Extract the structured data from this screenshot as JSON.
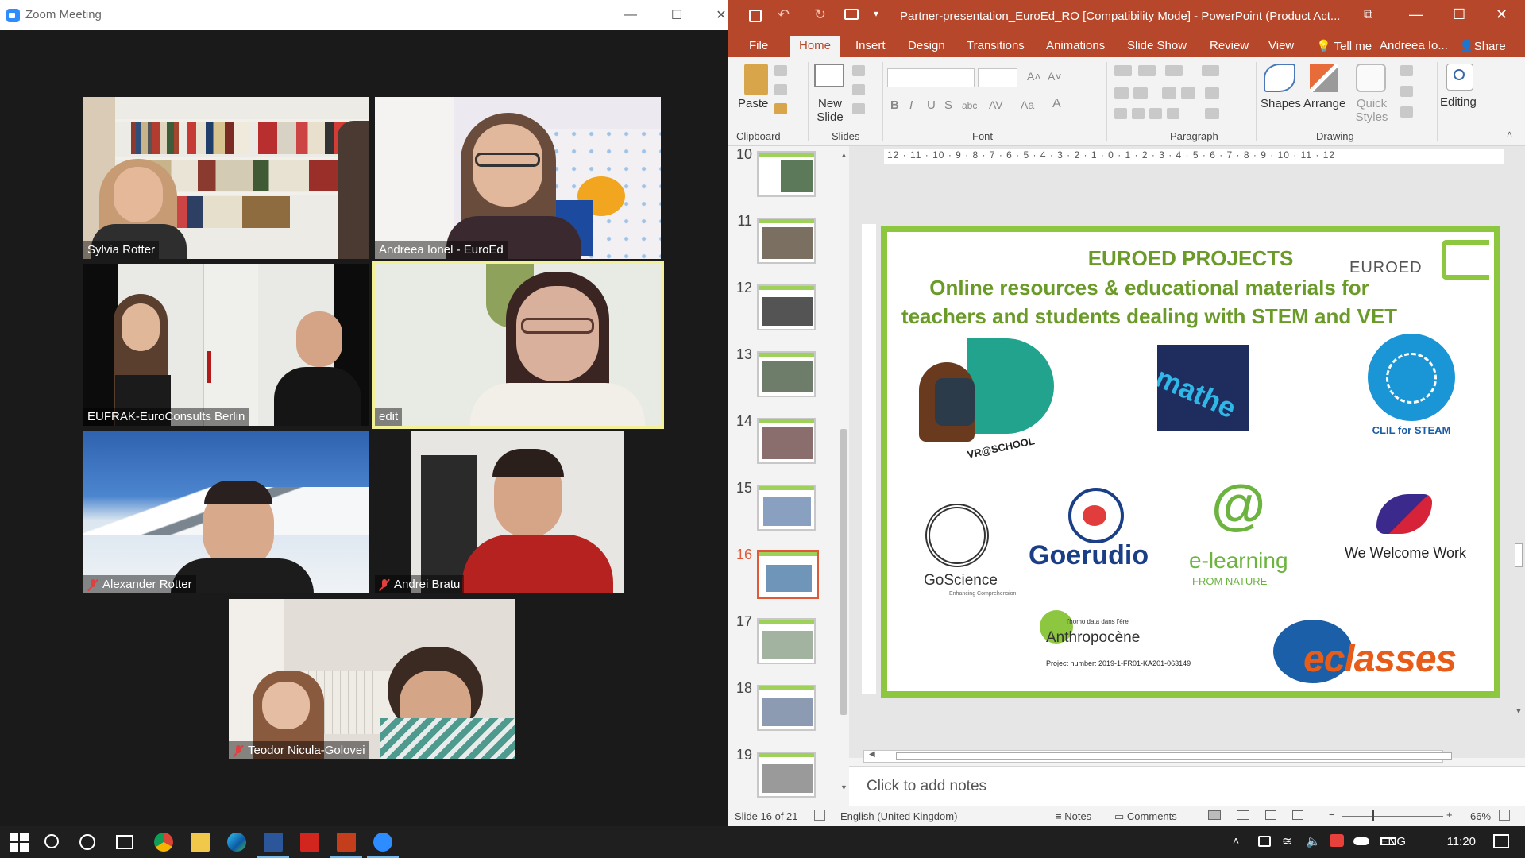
{
  "zoom": {
    "window_title": "Zoom Meeting",
    "participants": [
      {
        "name": "Sylvia Rotter",
        "muted": false
      },
      {
        "name": "Andreea Ionel - EuroEd",
        "muted": false
      },
      {
        "name": "EUFRAK-EuroConsults Berlin",
        "muted": false
      },
      {
        "name": "edit",
        "muted": false,
        "active_speaker": true
      },
      {
        "name": "Alexander Rotter",
        "muted": true
      },
      {
        "name": "Andrei Bratu",
        "muted": true
      },
      {
        "name": "Teodor Nicula-Golovei",
        "muted": true
      }
    ]
  },
  "ppt": {
    "doc_title": "Partner-presentation_EuroEd_RO [Compatibility Mode] - PowerPoint (Product Act...",
    "menu": [
      "File",
      "Home",
      "Insert",
      "Design",
      "Transitions",
      "Animations",
      "Slide Show",
      "Review",
      "View"
    ],
    "active_menu": "Home",
    "tell_me": "Tell me",
    "user": "Andreea Io...",
    "share": "Share",
    "ribbon": {
      "paste": "Paste",
      "new_slide": "New Slide",
      "shapes": "Shapes",
      "arrange": "Arrange",
      "quick_styles": "Quick Styles",
      "editing": "Editing",
      "groups": [
        "Clipboard",
        "Slides",
        "Font",
        "Paragraph",
        "Drawing"
      ]
    },
    "thumbnails": [
      "10",
      "11",
      "12",
      "13",
      "14",
      "15",
      "16",
      "17",
      "18",
      "19"
    ],
    "selected_slide": "16",
    "ruler_h": "12 · 11 · 10 · 9 · 8 · 7 · 6 · 5 · 4 · 3 · 2 · 1 · 0 · 1 · 2 · 3 · 4 · 5 · 6 · 7 · 8 · 9 · 10 · 11 · 12",
    "slide": {
      "title1": "EUROED PROJECTS",
      "title2": "Online resources & educational materials for teachers and students dealing with STEM and VET",
      "brand": "EUROED",
      "logos": {
        "vr": "VR@SCHOOL",
        "mathe": "mathe",
        "clil": "CLIL for STEAM",
        "goscience": "GoScience",
        "goscience_sub": "Enhancing Comprehension",
        "goerudio": "Goerudio",
        "elearning": "e-learning",
        "elearning_sub": "FROM NATURE",
        "welcome": "We Welcome Work",
        "anthropocene_small": "l'homo data dans l'ère",
        "anthropocene": "Anthropocène",
        "project_number": "Project number: 2019-1-FR01-KA201-063149",
        "classes": "eclasses"
      }
    },
    "notes_placeholder": "Click to add notes",
    "status": {
      "slide_info": "Slide 16 of 21",
      "language": "English (United Kingdom)",
      "notes": "Notes",
      "comments": "Comments",
      "zoom": "66%"
    }
  },
  "taskbar": {
    "lang": "ENG",
    "time": "11:20"
  }
}
